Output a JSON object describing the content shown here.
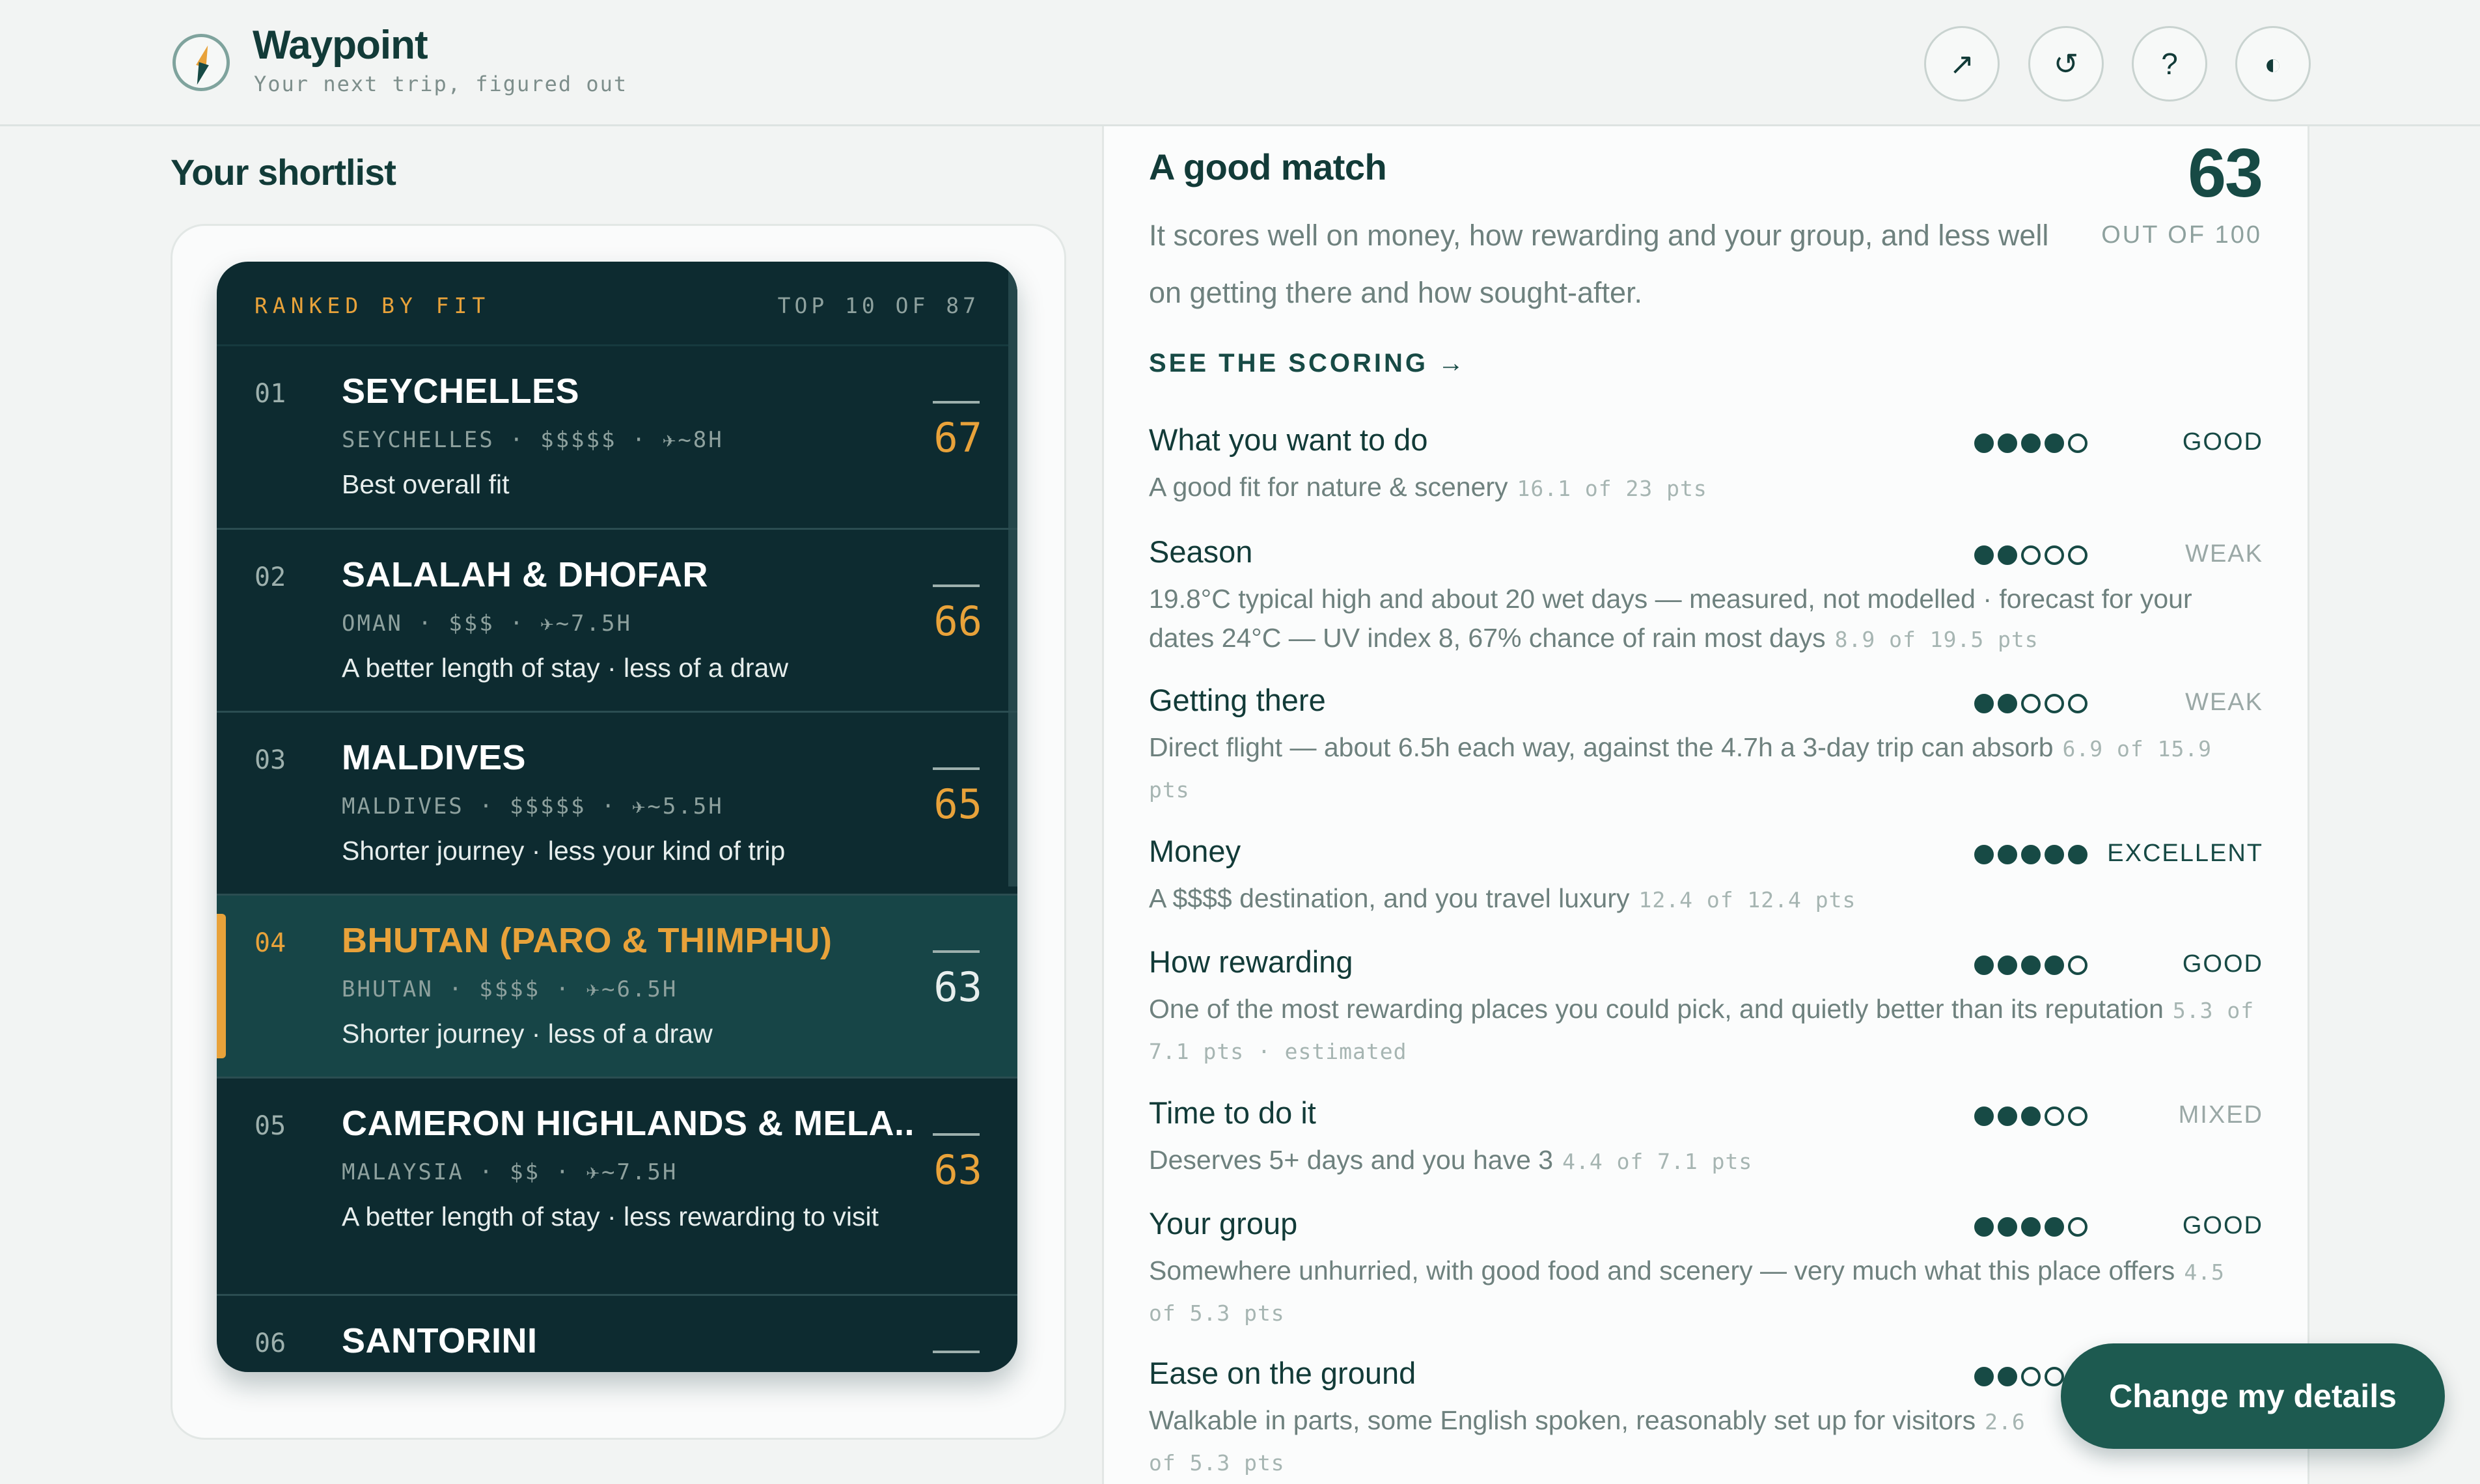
{
  "app": {
    "title": "Waypoint",
    "subtitle": "Your next trip, figured out"
  },
  "header_buttons": [
    {
      "icon": "arrow-up-right-icon",
      "glyph": "↗"
    },
    {
      "icon": "reset-icon",
      "glyph": "↺"
    },
    {
      "icon": "help-icon",
      "glyph": "?"
    },
    {
      "icon": "contrast-icon",
      "glyph": "◐"
    }
  ],
  "shortlist": {
    "title": "Your shortlist",
    "ranked_label": "RANKED BY FIT",
    "count_label": "TOP 10 OF 87",
    "items": [
      {
        "num": "01",
        "name": "SEYCHELLES",
        "meta": "SEYCHELLES · $$$$$ · ✈~8H",
        "why": "Best overall fit",
        "score": "67"
      },
      {
        "num": "02",
        "name": "SALALAH & DHOFAR",
        "meta": "OMAN · $$$ · ✈~7.5H",
        "why": "A better length of stay · less of a draw",
        "score": "66"
      },
      {
        "num": "03",
        "name": "MALDIVES",
        "meta": "MALDIVES · $$$$$ · ✈~5.5H",
        "why": "Shorter journey · less your kind of trip",
        "score": "65"
      },
      {
        "num": "04",
        "name": "BHUTAN (PARO & THIMPHU)",
        "meta": "BHUTAN · $$$$ · ✈~6.5H",
        "why": "Shorter journey · less of a draw",
        "score": "63"
      },
      {
        "num": "05",
        "name": "CAMERON HIGHLANDS & MELA...",
        "meta": "MALAYSIA · $$ · ✈~7.5H",
        "why": "A better length of stay · less rewarding to visit",
        "score": "63"
      },
      {
        "num": "06",
        "name": "SANTORINI",
        "meta": "",
        "why": "",
        "score": ""
      }
    ]
  },
  "detail": {
    "title": "A good match",
    "summary": "It scores well on money, how rewarding and your group, and less well on getting there and how sought-after.",
    "score": "63",
    "out_of": "OUT OF 100",
    "link": "SEE THE SCORING →",
    "criteria": [
      {
        "name": "What you want to do",
        "rating": 4,
        "label": "GOOD",
        "desc": "A good fit for nature & scenery",
        "pts": "16.1 of 23 pts"
      },
      {
        "name": "Season",
        "rating": 2,
        "label": "WEAK",
        "desc": "19.8°C typical high and about 20 wet days — measured, not modelled · forecast for your dates 24°C — UV index 8, 67% chance of rain most days",
        "pts": "8.9 of 19.5 pts"
      },
      {
        "name": "Getting there",
        "rating": 2,
        "label": "WEAK",
        "desc": "Direct flight — about 6.5h each way, against the 4.7h a 3-day trip can absorb",
        "pts": "6.9 of 15.9 pts"
      },
      {
        "name": "Money",
        "rating": 5,
        "label": "EXCELLENT",
        "desc": "A $$$$ destination, and you travel luxury",
        "pts": "12.4 of 12.4 pts"
      },
      {
        "name": "How rewarding",
        "rating": 4,
        "label": "GOOD",
        "desc": "One of the most rewarding places you could pick, and quietly better than its reputation",
        "pts": "5.3 of 7.1 pts · estimated"
      },
      {
        "name": "Time to do it",
        "rating": 3,
        "label": "MIXED",
        "desc": "Deserves 5+ days and you have 3",
        "pts": "4.4 of 7.1 pts"
      },
      {
        "name": "Your group",
        "rating": 4,
        "label": "GOOD",
        "desc": "Somewhere unhurried, with good food and scenery — very much what this place offers",
        "pts": "4.5 of 5.3 pts"
      },
      {
        "name": "Ease on the ground",
        "rating": 2,
        "label": "",
        "desc": "Walkable in parts, some English spoken, reasonably set up for visitors",
        "pts": "2.6 of 5.3 pts"
      }
    ]
  },
  "cta": {
    "label": "Change my details"
  },
  "colors": {
    "accent": "#e8a23a",
    "brand": "#174a45",
    "panel_dark": "#0d2b30",
    "good": "#174a45",
    "muted": "#8ea19e"
  }
}
